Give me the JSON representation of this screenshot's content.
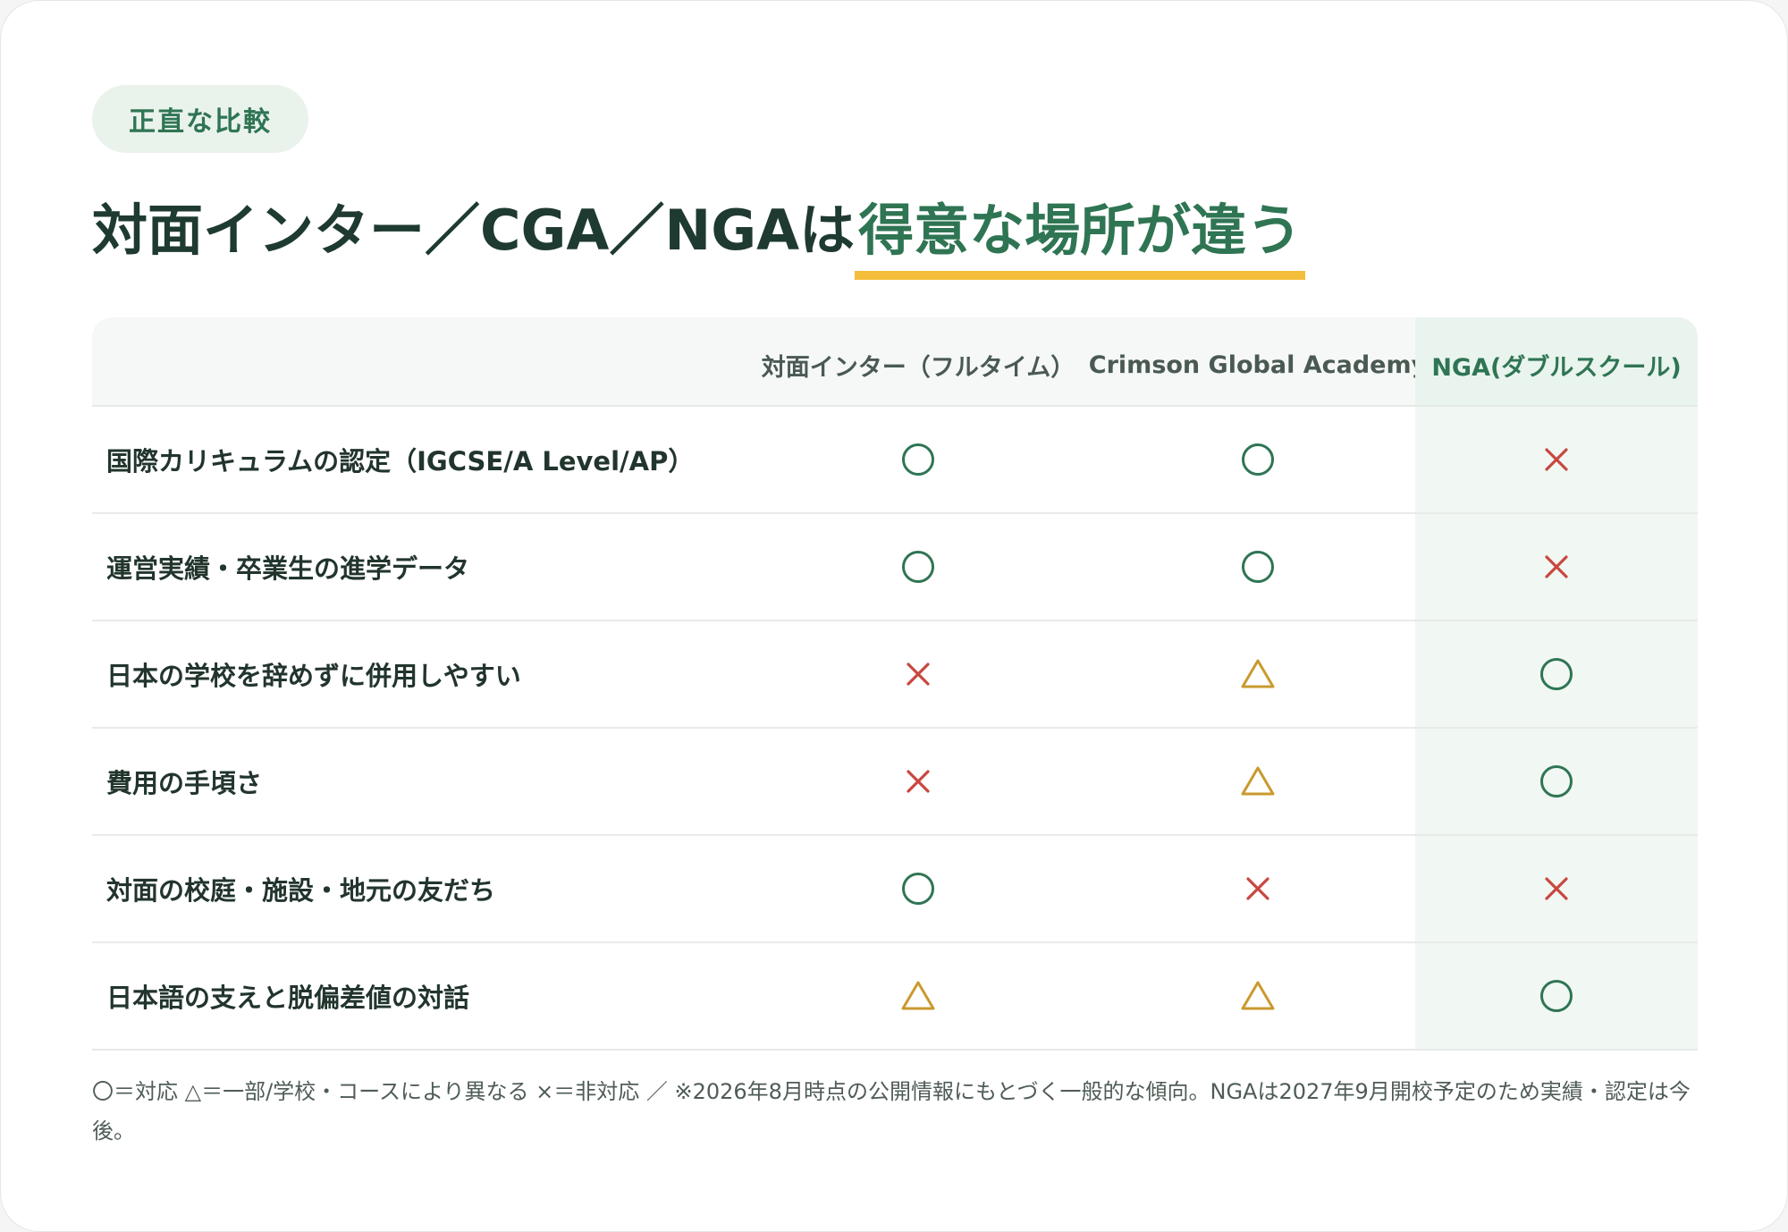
{
  "badge": "正直な比較",
  "title": {
    "plain": "対面インター／CGA／NGAは",
    "accent": "得意な場所が違う"
  },
  "table": {
    "headers": [
      "対面インター（フルタイム）",
      "Crimson Global Academy",
      "NGA(ダブルスクール)"
    ],
    "rows": [
      {
        "label": "国際カリキュラムの認定（IGCSE/A Level/AP）",
        "marks": [
          "circle",
          "circle",
          "cross"
        ]
      },
      {
        "label": "運営実績・卒業生の進学データ",
        "marks": [
          "circle",
          "circle",
          "cross"
        ]
      },
      {
        "label": "日本の学校を辞めずに併用しやすい",
        "marks": [
          "cross",
          "triangle",
          "circle"
        ]
      },
      {
        "label": "費用の手頃さ",
        "marks": [
          "cross",
          "triangle",
          "circle"
        ]
      },
      {
        "label": "対面の校庭・施設・地元の友だち",
        "marks": [
          "circle",
          "cross",
          "cross"
        ]
      },
      {
        "label": "日本語の支えと脱偏差値の対話",
        "marks": [
          "triangle",
          "triangle",
          "circle"
        ]
      }
    ]
  },
  "footnote": "〇＝対応 △＝一部/学校・コースにより異なる ×＝非対応 ／ ※2026年8月時点の公開情報にもとづく一般的な傾向。NGAは2027年9月開校予定のため実績・認定は今後。",
  "colors": {
    "circle": "#2f7553",
    "triangle": "#c99a2e",
    "cross": "#c8473f",
    "accent_underline": "#f5bd3c"
  }
}
